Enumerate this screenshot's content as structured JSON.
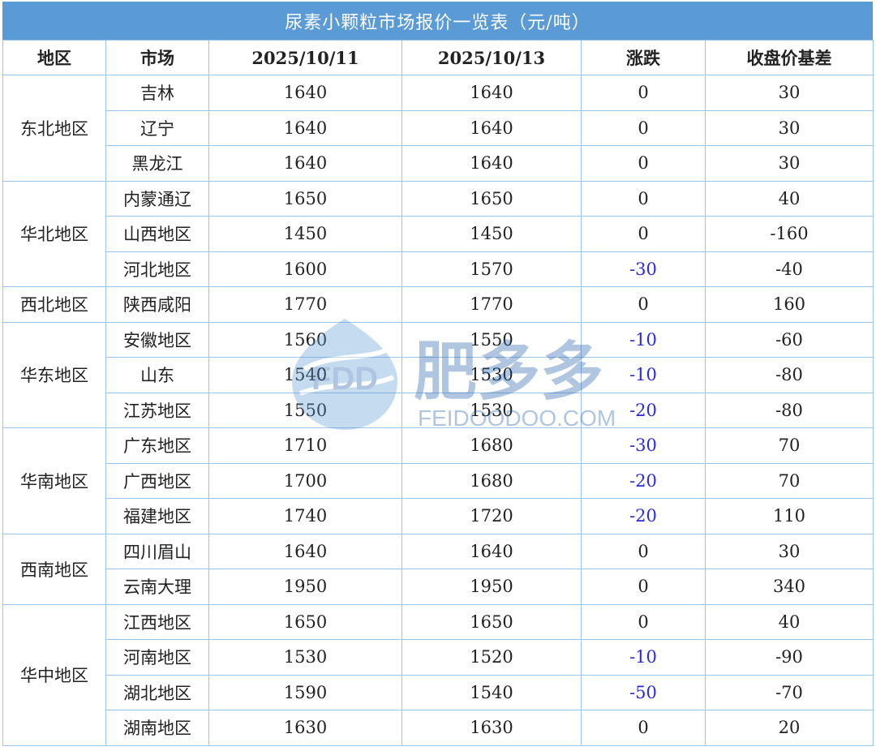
{
  "title": "尿素小颗粒市场报价一览表（元/吨）",
  "headers": [
    "地区",
    "市场",
    "2025/10/11",
    "2025/10/13",
    "涨跌",
    "收盘价基差"
  ],
  "watermark": {
    "brand_short": "FDD",
    "brand_cn": "肥多多",
    "brand_url": "FEIDOODOO.COM"
  },
  "colors": {
    "header_bg": "#5b9bd5",
    "border": "#9dc3e6",
    "negative_change": "#2b2bd9"
  },
  "regions": [
    {
      "name": "东北地区",
      "rows": [
        {
          "market": "吉林",
          "d1": "1640",
          "d2": "1640",
          "change": "0",
          "basis": "30"
        },
        {
          "market": "辽宁",
          "d1": "1640",
          "d2": "1640",
          "change": "0",
          "basis": "30"
        },
        {
          "market": "黑龙江",
          "d1": "1640",
          "d2": "1640",
          "change": "0",
          "basis": "30"
        }
      ]
    },
    {
      "name": "华北地区",
      "rows": [
        {
          "market": "内蒙通辽",
          "d1": "1650",
          "d2": "1650",
          "change": "0",
          "basis": "40"
        },
        {
          "market": "山西地区",
          "d1": "1450",
          "d2": "1450",
          "change": "0",
          "basis": "-160"
        },
        {
          "market": "河北地区",
          "d1": "1600",
          "d2": "1570",
          "change": "-30",
          "basis": "-40"
        }
      ]
    },
    {
      "name": "西北地区",
      "rows": [
        {
          "market": "陕西咸阳",
          "d1": "1770",
          "d2": "1770",
          "change": "0",
          "basis": "160"
        }
      ]
    },
    {
      "name": "华东地区",
      "rows": [
        {
          "market": "安徽地区",
          "d1": "1560",
          "d2": "1550",
          "change": "-10",
          "basis": "-60"
        },
        {
          "market": "山东",
          "d1": "1540",
          "d2": "1530",
          "change": "-10",
          "basis": "-80"
        },
        {
          "market": "江苏地区",
          "d1": "1550",
          "d2": "1530",
          "change": "-20",
          "basis": "-80"
        }
      ]
    },
    {
      "name": "华南地区",
      "rows": [
        {
          "market": "广东地区",
          "d1": "1710",
          "d2": "1680",
          "change": "-30",
          "basis": "70"
        },
        {
          "market": "广西地区",
          "d1": "1700",
          "d2": "1680",
          "change": "-20",
          "basis": "70"
        },
        {
          "market": "福建地区",
          "d1": "1740",
          "d2": "1720",
          "change": "-20",
          "basis": "110"
        }
      ]
    },
    {
      "name": "西南地区",
      "rows": [
        {
          "market": "四川眉山",
          "d1": "1640",
          "d2": "1640",
          "change": "0",
          "basis": "30"
        },
        {
          "market": "云南大理",
          "d1": "1950",
          "d2": "1950",
          "change": "0",
          "basis": "340"
        }
      ]
    },
    {
      "name": "华中地区",
      "rows": [
        {
          "market": "江西地区",
          "d1": "1650",
          "d2": "1650",
          "change": "0",
          "basis": "40"
        },
        {
          "market": "河南地区",
          "d1": "1530",
          "d2": "1520",
          "change": "-10",
          "basis": "-90"
        },
        {
          "market": "湖北地区",
          "d1": "1590",
          "d2": "1540",
          "change": "-50",
          "basis": "-70"
        },
        {
          "market": "湖南地区",
          "d1": "1630",
          "d2": "1630",
          "change": "0",
          "basis": "20"
        }
      ]
    }
  ]
}
